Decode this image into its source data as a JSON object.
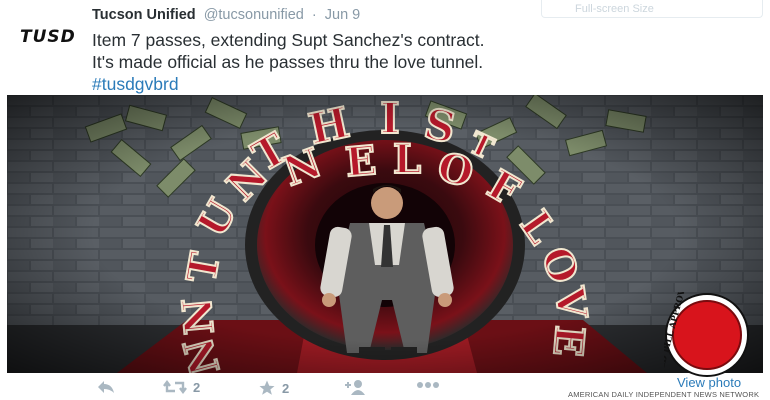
{
  "background_panel": {
    "label": "Full-screen Size"
  },
  "tweet": {
    "avatar_text": "TUSD",
    "display_name": "Tucson Unified",
    "handle": "@tucsonunified",
    "separator": "·",
    "date": "Jun 9",
    "text_line_1": "Item 7 passes, extending Supt Sanchez's contract.",
    "text_line_2": "It's made official as he passes thru the love tunnel.",
    "hashtag": "#tusdgvbrd"
  },
  "media": {
    "sign_words": [
      "THIS",
      "TUNNEL",
      "OF",
      "LOVE"
    ],
    "sign_text": "THIS TUNNEL OF LOVE"
  },
  "actions": {
    "reply_icon": "reply-icon",
    "retweet_icon": "retweet-icon",
    "retweet_count": "2",
    "favorite_icon": "star-icon",
    "favorite_count": "2",
    "follow_icon": "follow-icon",
    "more_icon": "more-icon"
  },
  "view_photo": "View photo",
  "stamp": {
    "text": "RED PILL APPROVED"
  },
  "footer_credit": "AMERICAN DAILY INDEPENDENT NEWS NETWORK",
  "colors": {
    "link": "#2b7bb9",
    "muted": "#8899a6",
    "action_icon": "#aab8c2",
    "sign_red": "#b5192a",
    "stamp_red": "#d8141c"
  }
}
